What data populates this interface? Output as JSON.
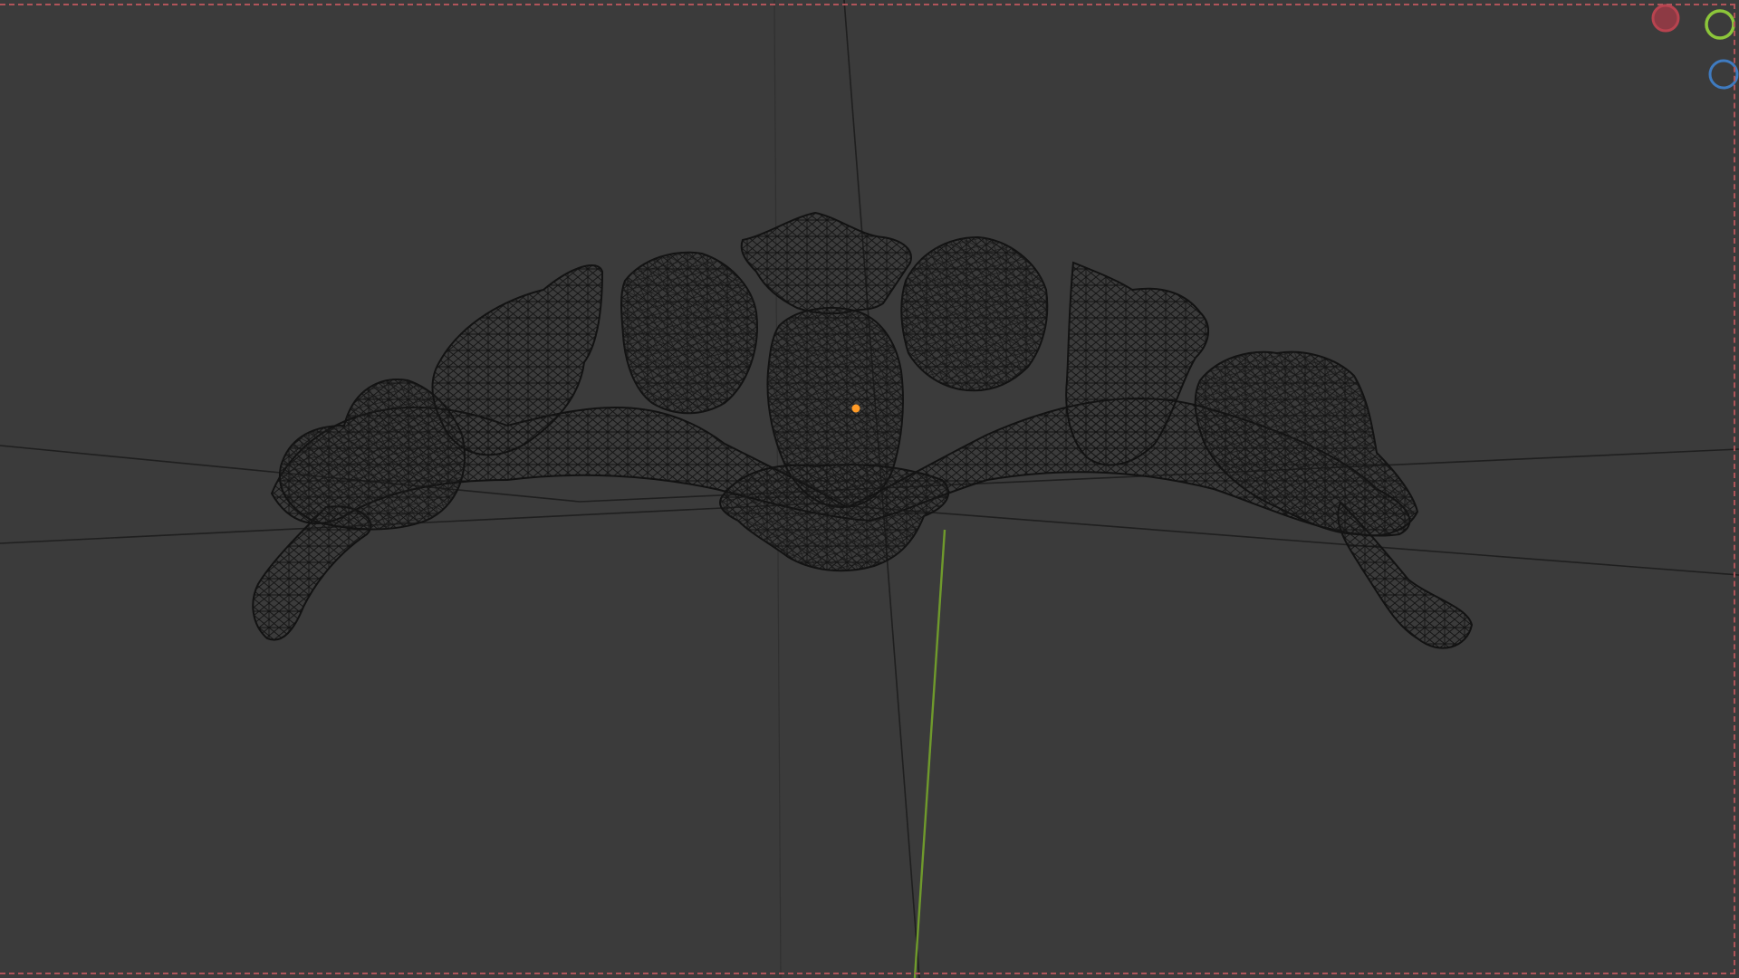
{
  "app": {
    "editor": "3D Viewport",
    "shading": "wireframe"
  },
  "colors": {
    "background": "#3b3b3b",
    "wire": "#111111",
    "axis_line": "#1e1e1e",
    "y_axis": "#6f9a2c",
    "origin": "#ff9a26",
    "active_border": "#b0545a",
    "gizmo_x": "#b8434f",
    "gizmo_y": "#8cc63a",
    "gizmo_z": "#3f7bc0"
  },
  "scene": {
    "object": {
      "shape": "floral-crown-garland",
      "mode": "wireframe"
    },
    "origin_icon": "origin-dot-icon"
  },
  "gizmo": {
    "axes": [
      {
        "name": "x",
        "icon": "axis-x-icon"
      },
      {
        "name": "y",
        "icon": "axis-y-icon"
      },
      {
        "name": "z",
        "icon": "axis-z-icon"
      }
    ]
  }
}
